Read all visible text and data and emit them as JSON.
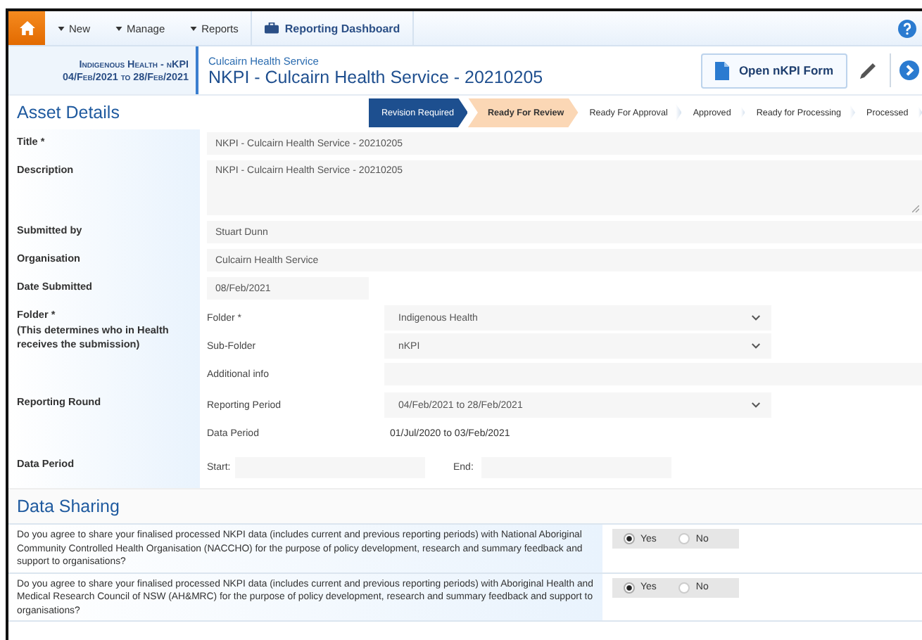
{
  "nav": {
    "items": [
      {
        "kind": "home",
        "selected": true
      },
      {
        "kind": "menu",
        "label": "New"
      },
      {
        "kind": "menu",
        "label": "Manage"
      },
      {
        "kind": "menu",
        "label": "Reports"
      },
      {
        "kind": "dashboard",
        "label": "Reporting Dashboard"
      }
    ]
  },
  "header": {
    "context_title": "Indigenous Health - nKPI",
    "context_dates": "04/Feb/2021 to 28/Feb/2021",
    "organisation": "Culcairn Health Service",
    "title": "NKPI - Culcairn Health Service - 20210205",
    "open_button": "Open nKPI Form"
  },
  "section_title": "Asset Details",
  "workflow": [
    {
      "label": "Revision Required",
      "current": true,
      "highlighted": false
    },
    {
      "label": "Ready For Review",
      "current": false,
      "highlighted": true
    },
    {
      "label": "Ready For Approval",
      "current": false,
      "highlighted": false
    },
    {
      "label": "Approved",
      "current": false,
      "highlighted": false
    },
    {
      "label": "Ready for Processing",
      "current": false,
      "highlighted": false
    },
    {
      "label": "Processed",
      "current": false,
      "highlighted": false
    }
  ],
  "form": [
    {
      "label": "Title *",
      "kind": "text",
      "value": "NKPI - Culcairn Health Service - 20210205"
    },
    {
      "label": "Description",
      "kind": "textarea",
      "value": "NKPI - Culcairn Health Service - 20210205"
    },
    {
      "label": "Submitted by",
      "kind": "text",
      "value": "Stuart Dunn"
    },
    {
      "label": "Organisation",
      "kind": "text",
      "value": "Culcairn Health Service"
    },
    {
      "label": "Date Submitted",
      "kind": "short",
      "value": "08/Feb/2021"
    },
    {
      "label": "Folder *",
      "note": "(This determines who in Health receives the submission)",
      "kind": "group",
      "fields": [
        {
          "label": "Folder *",
          "kind": "select",
          "value": "Indigenous Health"
        },
        {
          "label": "Sub-Folder",
          "kind": "select",
          "value": "nKPI"
        },
        {
          "label": "Additional info",
          "kind": "text"
        }
      ]
    },
    {
      "label": "Reporting Round",
      "kind": "group",
      "fields": [
        {
          "label": "Reporting Period",
          "kind": "select",
          "value": "04/Feb/2021 to 28/Feb/2021"
        },
        {
          "label": "Data Period",
          "kind": "plain",
          "value": "01/Jul/2020 to 03/Feb/2021"
        }
      ]
    },
    {
      "label": "Data Period",
      "kind": "daterange",
      "start_label": "Start:",
      "end_label": "End:"
    }
  ],
  "data_sharing": {
    "title": "Data Sharing",
    "questions": [
      {
        "text": "Do you agree to share your finalised processed NKPI data (includes current and previous reporting periods) with National Aboriginal Community Controlled Health Organisation (NACCHO) for the purpose of policy development, research and summary feedback and support to organisations?",
        "options": [
          {
            "label": "Yes",
            "selected": true
          },
          {
            "label": "No",
            "selected": false
          }
        ]
      },
      {
        "text": "Do you agree to share your finalised processed NKPI data (includes current and previous reporting periods) with Aboriginal Health and Medical Research Council of NSW (AH&MRC) for the purpose of policy development, research and summary feedback and support to organisations?",
        "options": [
          {
            "label": "Yes",
            "selected": true
          },
          {
            "label": "No",
            "selected": false
          }
        ]
      }
    ]
  }
}
